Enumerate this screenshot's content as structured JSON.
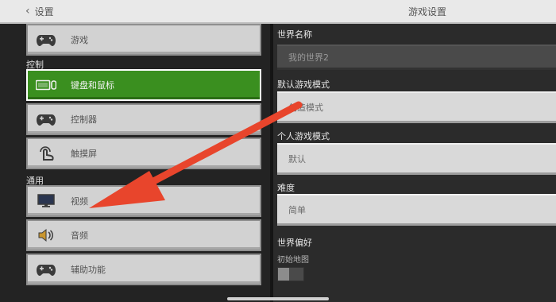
{
  "topbar": {
    "back_label": "设置",
    "title": "游戏设置"
  },
  "sidebar": {
    "top_item": {
      "label": "游戏",
      "icon": "gamepad-icon"
    },
    "sections": [
      {
        "title": "控制",
        "items": [
          {
            "label": "键盘和鼠标",
            "icon": "keyboard-mouse-icon",
            "active": true
          },
          {
            "label": "控制器",
            "icon": "gamepad-icon",
            "active": false
          },
          {
            "label": "触摸屏",
            "icon": "touch-hand-icon",
            "active": false
          }
        ]
      },
      {
        "title": "通用",
        "items": [
          {
            "label": "视频",
            "icon": "monitor-icon",
            "active": false
          },
          {
            "label": "音频",
            "icon": "speaker-icon",
            "active": false
          },
          {
            "label": "辅助功能",
            "icon": "gamepad-icon",
            "active": false
          }
        ]
      }
    ]
  },
  "settings": {
    "world_name": {
      "label": "世界名称",
      "value": "我的世界2"
    },
    "default_game_mode": {
      "label": "默认游戏模式",
      "value": "创造模式"
    },
    "personal_game_mode": {
      "label": "个人游戏模式",
      "value": "默认"
    },
    "difficulty": {
      "label": "难度",
      "value": "简单"
    },
    "world_preferences": {
      "label": "世界偏好",
      "starting_map_label": "初始地图",
      "starting_map_enabled": false
    }
  },
  "colors": {
    "active_green": "#3a8f1f",
    "annotation_arrow": "#e8452c"
  },
  "annotation": {
    "icon": "red-arrow-icon"
  }
}
